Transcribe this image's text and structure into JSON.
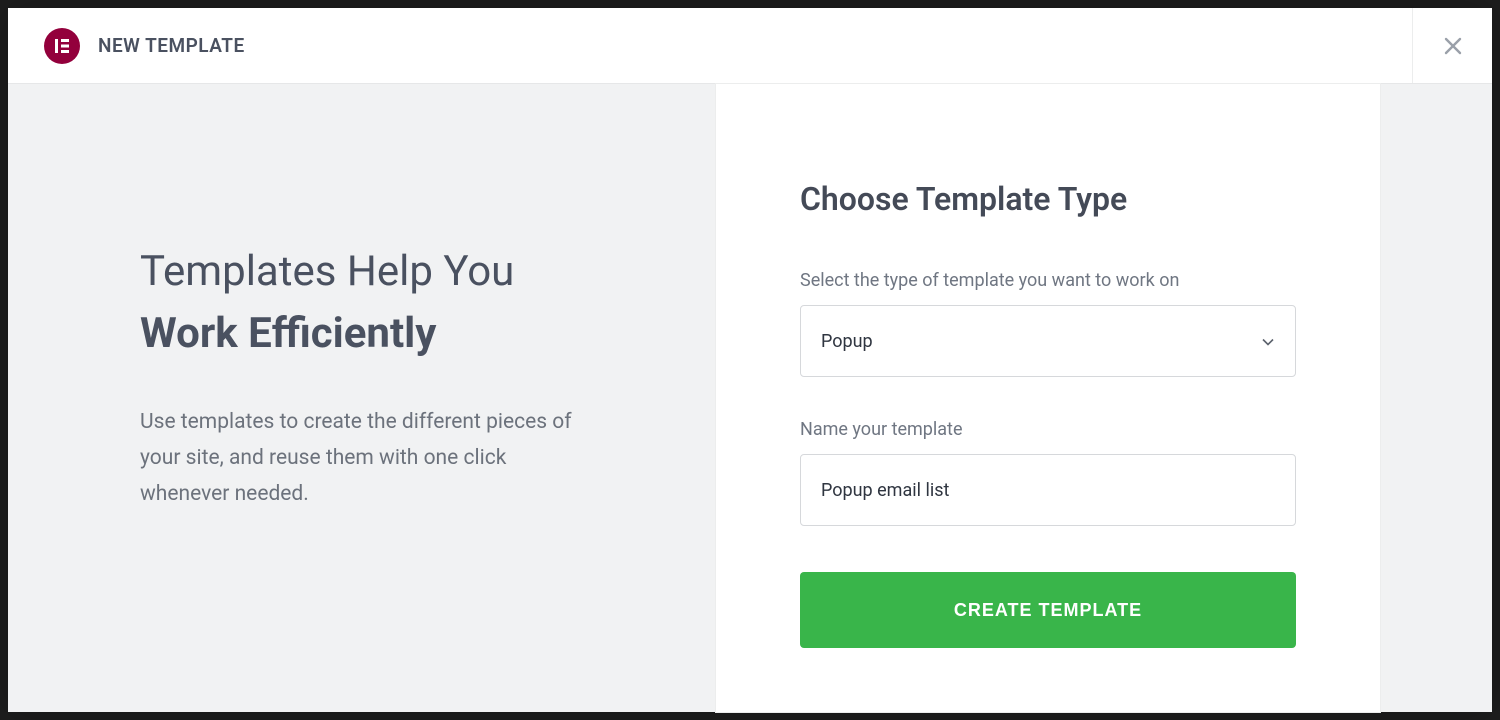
{
  "header": {
    "title": "NEW TEMPLATE"
  },
  "left": {
    "headline_line1": "Templates Help You",
    "headline_line2": "Work Efficiently",
    "description": "Use templates to create the different pieces of your site, and reuse them with one click whenever needed."
  },
  "form": {
    "title": "Choose Template Type",
    "type_label": "Select the type of template you want to work on",
    "type_value": "Popup",
    "name_label": "Name your template",
    "name_value": "Popup email list",
    "submit_label": "CREATE TEMPLATE"
  },
  "colors": {
    "brand": "#93003c",
    "accent": "#39b54a"
  },
  "icons": {
    "logo": "elementor-icon",
    "close": "close-icon",
    "caret": "chevron-down-icon"
  }
}
